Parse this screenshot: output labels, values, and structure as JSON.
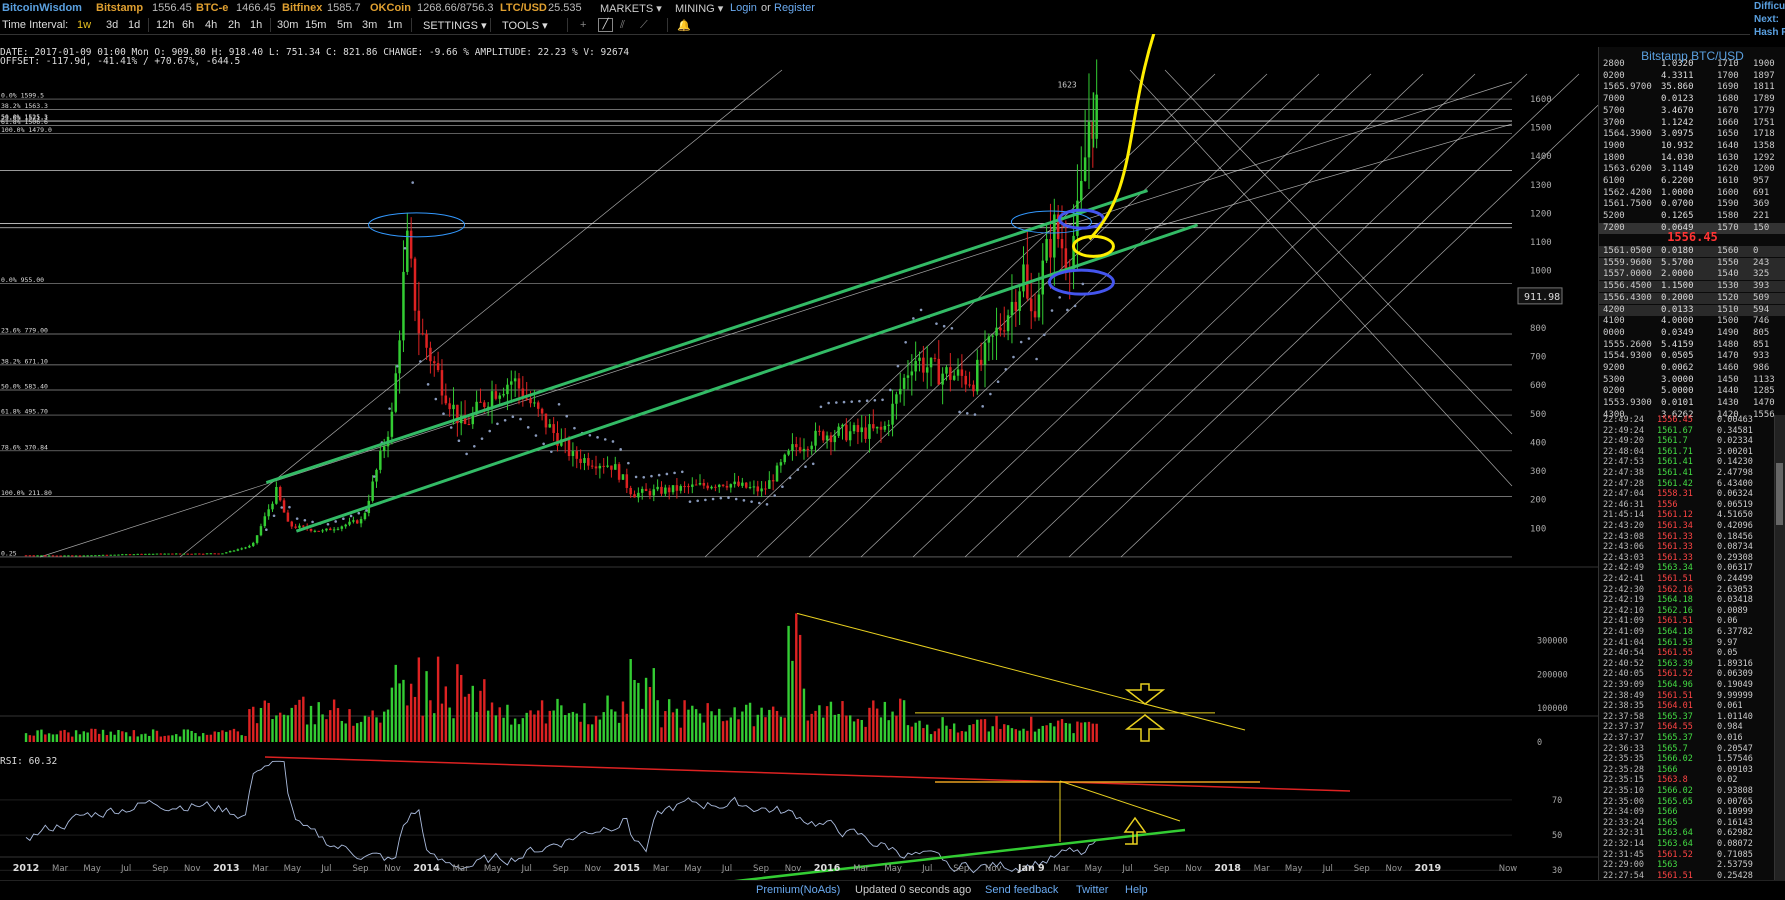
{
  "topbar": {
    "brand": "BitcoinWisdom",
    "markets": [
      {
        "name": "Bitstamp",
        "price": "1556.45"
      },
      {
        "name": "BTC-e",
        "price": "1466.45"
      },
      {
        "name": "Bitfinex",
        "price": "1585.7"
      },
      {
        "name": "OKCoin",
        "price": "1268.66/8756.3"
      },
      {
        "name": "LTC/USD",
        "price": "25.535"
      }
    ],
    "nav": {
      "markets": "MARKETS",
      "mining": "MINING",
      "login": "Login",
      "or": "or",
      "register": "Register"
    }
  },
  "toolbar": {
    "label": "Time Interval:",
    "intervals": [
      "1w",
      "3d",
      "1d",
      "12h",
      "6h",
      "4h",
      "2h",
      "1h",
      "30m",
      "15m",
      "5m",
      "3m",
      "1m"
    ],
    "active_interval": "1w",
    "settings": "SETTINGS",
    "tools": "TOOLS"
  },
  "info": {
    "line1": "DATE: 2017-01-09 01:00 Mon    O: 909.80    H: 918.40    L: 751.34    C: 821.86    CHANGE: -9.66 %    AMPLITUDE: 22.23 %    V: 92674",
    "line2": "OFFSET: -117.9d, -41.41% / +70.67%, -644.5"
  },
  "far_right": {
    "line1": "Difficu",
    "line2": "Next:",
    "line3": "Hash R"
  },
  "orderbook": {
    "title": "Bitstamp BTC/USD",
    "current_price": "1556.45",
    "asks": [
      {
        "price": "2800",
        "amount": "1.0320",
        "depth_price": "1710",
        "depth": "1900"
      },
      {
        "price": "0200",
        "amount": "4.3311",
        "depth_price": "1700",
        "depth": "1897"
      },
      {
        "price": "1565.9700",
        "amount": "35.860",
        "depth_price": "1690",
        "depth": "1811"
      },
      {
        "price": "7000",
        "amount": "0.0123",
        "depth_price": "1680",
        "depth": "1789"
      },
      {
        "price": "5700",
        "amount": "3.4670",
        "depth_price": "1670",
        "depth": "1779"
      },
      {
        "price": "3700",
        "amount": "1.1242",
        "depth_price": "1660",
        "depth": "1751"
      },
      {
        "price": "1564.3900",
        "amount": "3.0975",
        "depth_price": "1650",
        "depth": "1718"
      },
      {
        "price": "1900",
        "amount": "10.932",
        "depth_price": "1640",
        "depth": "1358"
      },
      {
        "price": "1800",
        "amount": "14.030",
        "depth_price": "1630",
        "depth": "1292"
      },
      {
        "price": "1563.6200",
        "amount": "3.1149",
        "depth_price": "1620",
        "depth": "1200"
      },
      {
        "price": "6100",
        "amount": "6.2200",
        "depth_price": "1610",
        "depth": "957"
      },
      {
        "price": "1562.4200",
        "amount": "1.0000",
        "depth_price": "1600",
        "depth": "691"
      },
      {
        "price": "1561.7500",
        "amount": "0.0700",
        "depth_price": "1590",
        "depth": "369"
      },
      {
        "price": "5200",
        "amount": "0.1265",
        "depth_price": "1580",
        "depth": "221"
      },
      {
        "price": "7200",
        "amount": "0.0649",
        "depth_price": "1570",
        "depth": "150"
      }
    ],
    "bids": [
      {
        "price": "1561.0500",
        "amount": "0.0180",
        "depth_price": "1560",
        "depth": "0"
      },
      {
        "price": "1559.9600",
        "amount": "5.5700",
        "depth_price": "1550",
        "depth": "243"
      },
      {
        "price": "1557.0000",
        "amount": "2.0000",
        "depth_price": "1540",
        "depth": "325"
      },
      {
        "price": "1556.4500",
        "amount": "1.1500",
        "depth_price": "1530",
        "depth": "393"
      },
      {
        "price": "1556.4300",
        "amount": "0.2000",
        "depth_price": "1520",
        "depth": "509"
      },
      {
        "price": "4200",
        "amount": "0.0133",
        "depth_price": "1510",
        "depth": "594"
      },
      {
        "price": "4100",
        "amount": "4.0000",
        "depth_price": "1500",
        "depth": "746"
      },
      {
        "price": "0000",
        "amount": "0.0349",
        "depth_price": "1490",
        "depth": "805"
      },
      {
        "price": "1555.2600",
        "amount": "5.4159",
        "depth_price": "1480",
        "depth": "851"
      },
      {
        "price": "1554.9300",
        "amount": "0.0505",
        "depth_price": "1470",
        "depth": "933"
      },
      {
        "price": "9200",
        "amount": "0.0062",
        "depth_price": "1460",
        "depth": "986"
      },
      {
        "price": "5300",
        "amount": "3.0000",
        "depth_price": "1450",
        "depth": "1133"
      },
      {
        "price": "0200",
        "amount": "5.0000",
        "depth_price": "1440",
        "depth": "1285"
      },
      {
        "price": "1553.9300",
        "amount": "0.0101",
        "depth_price": "1430",
        "depth": "1470"
      },
      {
        "price": "4300",
        "amount": "3.6262",
        "depth_price": "1420",
        "depth": "1556"
      }
    ]
  },
  "trades": [
    {
      "time": "22:49:24",
      "price": "1556.45",
      "amount": "0.00463",
      "side": "sell"
    },
    {
      "time": "22:49:24",
      "price": "1561.67",
      "amount": "0.34581",
      "side": "buy"
    },
    {
      "time": "22:49:20",
      "price": "1561.7",
      "amount": "0.02334",
      "side": "buy"
    },
    {
      "time": "22:48:04",
      "price": "1561.71",
      "amount": "3.00201",
      "side": "buy"
    },
    {
      "time": "22:47:53",
      "price": "1561.41",
      "amount": "0.14230",
      "side": "buy"
    },
    {
      "time": "22:47:38",
      "price": "1561.41",
      "amount": "2.47798",
      "side": "buy"
    },
    {
      "time": "22:47:28",
      "price": "1561.42",
      "amount": "6.43400",
      "side": "buy"
    },
    {
      "time": "22:47:04",
      "price": "1558.31",
      "amount": "0.06324",
      "side": "sell"
    },
    {
      "time": "22:46:31",
      "price": "1556",
      "amount": "0.06519",
      "side": "sell"
    },
    {
      "time": "21:45:14",
      "price": "1561.12",
      "amount": "4.51650",
      "side": "sell"
    },
    {
      "time": "22:43:20",
      "price": "1561.34",
      "amount": "0.42096",
      "side": "sell"
    },
    {
      "time": "22:43:08",
      "price": "1561.33",
      "amount": "0.18456",
      "side": "sell"
    },
    {
      "time": "22:43:06",
      "price": "1561.33",
      "amount": "0.08734",
      "side": "sell"
    },
    {
      "time": "22:43:03",
      "price": "1561.33",
      "amount": "0.29308",
      "side": "sell"
    },
    {
      "time": "22:42:49",
      "price": "1563.34",
      "amount": "0.06317",
      "side": "buy"
    },
    {
      "time": "22:42:41",
      "price": "1561.51",
      "amount": "0.24499",
      "side": "sell"
    },
    {
      "time": "22:42:30",
      "price": "1562.16",
      "amount": "2.63053",
      "side": "sell"
    },
    {
      "time": "22:42:19",
      "price": "1564.18",
      "amount": "0.03418",
      "side": "buy"
    },
    {
      "time": "22:42:10",
      "price": "1562.16",
      "amount": "0.0089",
      "side": "buy"
    },
    {
      "time": "22:41:09",
      "price": "1561.51",
      "amount": "0.06",
      "side": "sell"
    },
    {
      "time": "22:41:09",
      "price": "1564.18",
      "amount": "6.37782",
      "side": "buy"
    },
    {
      "time": "22:41:04",
      "price": "1561.53",
      "amount": "9.97",
      "side": "buy"
    },
    {
      "time": "22:40:54",
      "price": "1561.55",
      "amount": "0.05",
      "side": "sell"
    },
    {
      "time": "22:40:52",
      "price": "1563.39",
      "amount": "1.89316",
      "side": "buy"
    },
    {
      "time": "22:40:05",
      "price": "1561.52",
      "amount": "0.06309",
      "side": "sell"
    },
    {
      "time": "22:39:09",
      "price": "1564.96",
      "amount": "0.19049",
      "side": "buy"
    },
    {
      "time": "22:38:49",
      "price": "1561.51",
      "amount": "9.99999",
      "side": "sell"
    },
    {
      "time": "22:38:35",
      "price": "1564.01",
      "amount": "0.061",
      "side": "sell"
    },
    {
      "time": "22:37:58",
      "price": "1565.37",
      "amount": "1.01140",
      "side": "buy"
    },
    {
      "time": "22:37:37",
      "price": "1564.55",
      "amount": "0.984",
      "side": "sell"
    },
    {
      "time": "22:37:37",
      "price": "1565.37",
      "amount": "0.016",
      "side": "buy"
    },
    {
      "time": "22:36:33",
      "price": "1565.7",
      "amount": "0.20547",
      "side": "buy"
    },
    {
      "time": "22:35:35",
      "price": "1566.02",
      "amount": "1.57546",
      "side": "buy"
    },
    {
      "time": "22:35:28",
      "price": "1566",
      "amount": "0.09103",
      "side": "buy"
    },
    {
      "time": "22:35:15",
      "price": "1563.8",
      "amount": "0.02",
      "side": "sell"
    },
    {
      "time": "22:35:10",
      "price": "1566.02",
      "amount": "0.93808",
      "side": "buy"
    },
    {
      "time": "22:35:00",
      "price": "1565.65",
      "amount": "0.00765",
      "side": "buy"
    },
    {
      "time": "22:34:09",
      "price": "1566",
      "amount": "0.10999",
      "side": "buy"
    },
    {
      "time": "22:33:24",
      "price": "1565",
      "amount": "0.16143",
      "side": "buy"
    },
    {
      "time": "22:32:31",
      "price": "1563.64",
      "amount": "0.62982",
      "side": "buy"
    },
    {
      "time": "22:32:14",
      "price": "1563.64",
      "amount": "0.08072",
      "side": "buy"
    },
    {
      "time": "22:31:45",
      "price": "1561.52",
      "amount": "0.71085",
      "side": "sell"
    },
    {
      "time": "22:29:00",
      "price": "1563",
      "amount": "2.53759",
      "side": "buy"
    },
    {
      "time": "22:27:54",
      "price": "1561.51",
      "amount": "0.25428",
      "side": "sell"
    }
  ],
  "chart_data": [
    {
      "type": "candlestick",
      "title": "",
      "interval": "1w",
      "ylim": [
        0,
        1680
      ],
      "y_ticks": [
        100,
        200,
        300,
        400,
        500,
        600,
        700,
        800,
        900,
        1000,
        1100,
        1200,
        1300,
        1400,
        1500,
        1600
      ],
      "last_price_label": "911.98",
      "peak_label": "1623",
      "x_ticks": [
        {
          "label": "2012",
          "t": 2012.0
        },
        {
          "label": "Mar",
          "t": 2012.17
        },
        {
          "label": "May",
          "t": 2012.33
        },
        {
          "label": "Jul",
          "t": 2012.5
        },
        {
          "label": "Sep",
          "t": 2012.67
        },
        {
          "label": "Nov",
          "t": 2012.83
        },
        {
          "label": "2013",
          "t": 2013.0
        },
        {
          "label": "Mar",
          "t": 2013.17
        },
        {
          "label": "May",
          "t": 2013.33
        },
        {
          "label": "Jul",
          "t": 2013.5
        },
        {
          "label": "Sep",
          "t": 2013.67
        },
        {
          "label": "Nov",
          "t": 2013.83
        },
        {
          "label": "2014",
          "t": 2014.0
        },
        {
          "label": "Mar",
          "t": 2014.17
        },
        {
          "label": "May",
          "t": 2014.33
        },
        {
          "label": "Jul",
          "t": 2014.5
        },
        {
          "label": "Sep",
          "t": 2014.67
        },
        {
          "label": "Nov",
          "t": 2014.83
        },
        {
          "label": "2015",
          "t": 2015.0
        },
        {
          "label": "Mar",
          "t": 2015.17
        },
        {
          "label": "May",
          "t": 2015.33
        },
        {
          "label": "Jul",
          "t": 2015.5
        },
        {
          "label": "Sep",
          "t": 2015.67
        },
        {
          "label": "Nov",
          "t": 2015.83
        },
        {
          "label": "2016",
          "t": 2016.0
        },
        {
          "label": "Mar",
          "t": 2016.17
        },
        {
          "label": "May",
          "t": 2016.33
        },
        {
          "label": "Jul",
          "t": 2016.5
        },
        {
          "label": "Sep",
          "t": 2016.67
        },
        {
          "label": "Nov",
          "t": 2016.83
        },
        {
          "label": "Jan 9",
          "t": 2017.02
        },
        {
          "label": "Mar",
          "t": 2017.17
        },
        {
          "label": "May",
          "t": 2017.33
        },
        {
          "label": "Jul",
          "t": 2017.5
        },
        {
          "label": "Sep",
          "t": 2017.67
        },
        {
          "label": "Nov",
          "t": 2017.83
        },
        {
          "label": "2018",
          "t": 2018.0
        },
        {
          "label": "Mar",
          "t": 2018.17
        },
        {
          "label": "May",
          "t": 2018.33
        },
        {
          "label": "Jul",
          "t": 2018.5
        },
        {
          "label": "Sep",
          "t": 2018.67
        },
        {
          "label": "Nov",
          "t": 2018.83
        },
        {
          "label": "2019",
          "t": 2019.0
        },
        {
          "label": "Now",
          "t": 2019.4
        }
      ],
      "fib_levels": [
        {
          "label": "0.0% 1599.5",
          "value": 1599.5
        },
        {
          "label": "23.6% 1521.1",
          "value": 1521.1
        },
        {
          "label": "38.2% 1563.3",
          "value": 1563.3
        },
        {
          "label": "50.0% 1525.3",
          "value": 1525.3
        },
        {
          "label": "61.8% 1506.6",
          "value": 1506.6
        },
        {
          "label": "100.0% 1479.0",
          "value": 1479.0
        },
        {
          "label": "0.0% 955.00",
          "value": 955
        },
        {
          "label": "23.6% 779.00",
          "value": 779
        },
        {
          "label": "38.2% 671.10",
          "value": 671.1
        },
        {
          "label": "50.0% 583.40",
          "value": 583.4
        },
        {
          "label": "61.8% 495.70",
          "value": 495.7
        },
        {
          "label": "78.6% 370.84",
          "value": 370.84
        },
        {
          "label": "100.0% 211.80",
          "value": 211.8
        },
        {
          "label": "0.25",
          "value": 0.25
        }
      ],
      "extra_hlines": [
        1350,
        1165,
        1150
      ],
      "price_path": [
        {
          "t": 2012.0,
          "v": 6
        },
        {
          "t": 2012.3,
          "v": 5
        },
        {
          "t": 2012.6,
          "v": 11
        },
        {
          "t": 2012.9,
          "v": 12
        },
        {
          "t": 2013.0,
          "v": 13
        },
        {
          "t": 2013.15,
          "v": 40
        },
        {
          "t": 2013.27,
          "v": 230
        },
        {
          "t": 2013.33,
          "v": 110
        },
        {
          "t": 2013.5,
          "v": 90
        },
        {
          "t": 2013.7,
          "v": 130
        },
        {
          "t": 2013.85,
          "v": 500
        },
        {
          "t": 2013.92,
          "v": 1100
        },
        {
          "t": 2013.98,
          "v": 800
        },
        {
          "t": 2014.1,
          "v": 600
        },
        {
          "t": 2014.2,
          "v": 450
        },
        {
          "t": 2014.35,
          "v": 580
        },
        {
          "t": 2014.45,
          "v": 620
        },
        {
          "t": 2014.6,
          "v": 480
        },
        {
          "t": 2014.75,
          "v": 350
        },
        {
          "t": 2014.95,
          "v": 320
        },
        {
          "t": 2015.05,
          "v": 220
        },
        {
          "t": 2015.3,
          "v": 240
        },
        {
          "t": 2015.5,
          "v": 260
        },
        {
          "t": 2015.7,
          "v": 230
        },
        {
          "t": 2015.85,
          "v": 380
        },
        {
          "t": 2016.0,
          "v": 430
        },
        {
          "t": 2016.3,
          "v": 440
        },
        {
          "t": 2016.45,
          "v": 700
        },
        {
          "t": 2016.55,
          "v": 650
        },
        {
          "t": 2016.75,
          "v": 620
        },
        {
          "t": 2016.95,
          "v": 900
        },
        {
          "t": 2017.0,
          "v": 1000
        },
        {
          "t": 2017.03,
          "v": 820
        },
        {
          "t": 2017.15,
          "v": 1150
        },
        {
          "t": 2017.22,
          "v": 1050
        },
        {
          "t": 2017.28,
          "v": 1200
        },
        {
          "t": 2017.33,
          "v": 1550
        },
        {
          "t": 2017.36,
          "v": 1556
        }
      ],
      "trendlines_green": [
        {
          "from": {
            "t": 2013.2,
            "v": 260
          },
          "to": {
            "t": 2017.6,
            "v": 1280
          }
        },
        {
          "from": {
            "t": 2013.35,
            "v": 90
          },
          "to": {
            "t": 2017.85,
            "v": 1160
          }
        }
      ],
      "annotation_circles": [
        {
          "t": 2013.95,
          "v": 1150,
          "color": "#3399ff"
        },
        {
          "t": 2017.13,
          "v": 1165,
          "color": "#3399ff"
        },
        {
          "t": 2017.25,
          "v": 1180,
          "color": "#4444dd"
        },
        {
          "t": 2017.27,
          "v": 960,
          "color": "#4444dd"
        },
        {
          "t": 2017.32,
          "v": 1080,
          "color": "#ffee00"
        }
      ]
    },
    {
      "type": "bar",
      "title": "",
      "series_name": "Volume",
      "y_ticks": [
        0,
        100000,
        200000,
        300000
      ],
      "ylim": [
        0,
        390000
      ],
      "peak": {
        "t": 2015.85,
        "v": 380000
      },
      "recent_level": 92674
    },
    {
      "type": "line",
      "title": "RSI: 60.32",
      "series_name": "RSI",
      "y_ticks": [
        30,
        50,
        70
      ],
      "ylim": [
        25,
        95
      ],
      "last_value": 60.32
    }
  ],
  "footer": {
    "premium": "Premium(NoAds)",
    "updated": "Updated 0 seconds ago",
    "feedback": "Send feedback",
    "twitter": "Twitter",
    "help": "Help"
  }
}
